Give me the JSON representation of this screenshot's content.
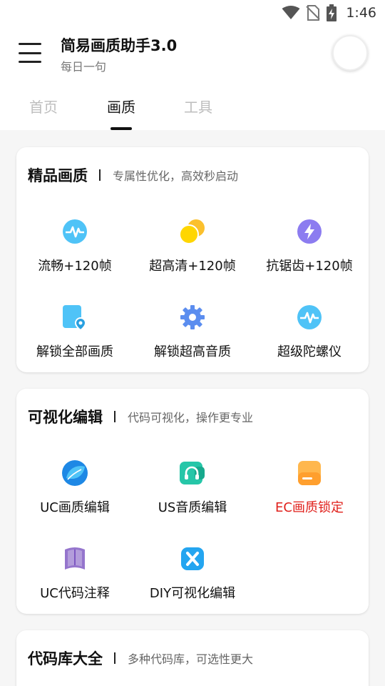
{
  "status_bar": {
    "time": "1:46"
  },
  "header": {
    "title": "简易画质助手3.0",
    "subtitle": "每日一句"
  },
  "tabs": [
    {
      "label": "首页",
      "active": false
    },
    {
      "label": "画质",
      "active": true
    },
    {
      "label": "工具",
      "active": false
    }
  ],
  "cards": [
    {
      "title": "精品画质",
      "subtitle": "专属性优化，高效秒启动",
      "items": [
        {
          "label": "流畅+120帧",
          "icon": "pulse-icon"
        },
        {
          "label": "超高清+120帧",
          "icon": "circles-icon"
        },
        {
          "label": "抗锯齿+120帧",
          "icon": "bolt-icon"
        },
        {
          "label": "解锁全部画质",
          "icon": "location-doc-icon"
        },
        {
          "label": "解锁超高音质",
          "icon": "gear-icon"
        },
        {
          "label": "超级陀螺仪",
          "icon": "pulse-icon"
        }
      ]
    },
    {
      "title": "可视化编辑",
      "subtitle": "代码可视化，操作更专业",
      "items": [
        {
          "label": "UC画质编辑",
          "icon": "blue-leaf-icon"
        },
        {
          "label": "US音质编辑",
          "icon": "headphone-icon"
        },
        {
          "label": "EC画质锁定",
          "icon": "orange-card-icon",
          "color": "#e0201b"
        },
        {
          "label": "UC代码注释",
          "icon": "purple-book-icon"
        },
        {
          "label": "DIY可视化编辑",
          "icon": "blue-x-icon"
        }
      ]
    },
    {
      "title": "代码库大全",
      "subtitle": "多种代码库，可选性更大"
    }
  ]
}
